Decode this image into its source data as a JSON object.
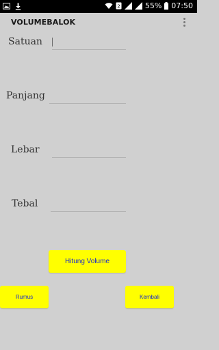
{
  "status_bar": {
    "battery": "55%",
    "time": "07:50",
    "icons": [
      "image-icon",
      "download-icon",
      "wifi-icon",
      "data-icon",
      "signal-icon",
      "signal-icon",
      "battery-icon"
    ]
  },
  "app_bar": {
    "title": "VOLUMEBALOK",
    "menu_icon": "overflow-menu-icon"
  },
  "form": {
    "satuan": {
      "label": "Satuan",
      "value": ""
    },
    "panjang": {
      "label": "Panjang",
      "value": ""
    },
    "lebar": {
      "label": "Lebar",
      "value": ""
    },
    "tebal": {
      "label": "Tebal",
      "value": ""
    }
  },
  "buttons": {
    "hitung": "Hitung Volume",
    "rumus": "Rumus",
    "kembali": "Kembali"
  },
  "colors": {
    "background": "#d0d0d0",
    "button": "#ffff00",
    "button_text": "#1a2bcc"
  }
}
